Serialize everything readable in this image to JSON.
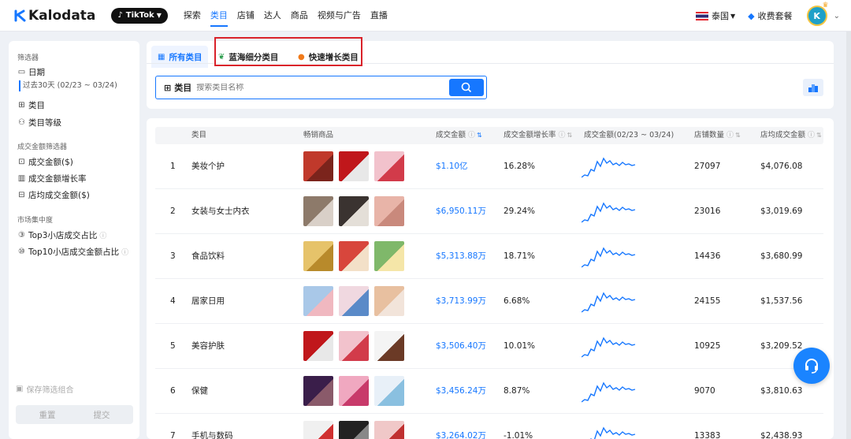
{
  "brand": {
    "name": "Kalodata",
    "platform": "TikTok"
  },
  "nav": [
    "探索",
    "类目",
    "店铺",
    "达人",
    "商品",
    "视频与广告",
    "直播"
  ],
  "nav_active": 1,
  "header": {
    "region": "泰国",
    "plan": "收费套餐",
    "avatar_letter": "K"
  },
  "sidebar": {
    "filters_title": "筛选器",
    "date_label": "日期",
    "date_range": "过去30天 (02/23 ~ 03/24)",
    "category_label": "类目",
    "category_level_label": "类目等级",
    "sales_filter_title": "成交金额筛选器",
    "sales_items": [
      "成交金额($)",
      "成交金额增长率",
      "店均成交金额($)"
    ],
    "market_title": "市场集中度",
    "market_items": [
      "Top3小店成交占比",
      "Top10小店成交金额占比"
    ],
    "save_combo": "保存筛选组合",
    "reset_label": "重置",
    "submit_label": "提交"
  },
  "tabs": [
    "所有类目",
    "蓝海细分类目",
    "快速增长类目"
  ],
  "search": {
    "category_label": "类目",
    "placeholder": "搜索类目名称"
  },
  "table": {
    "headers": [
      "类目",
      "畅销商品",
      "成交金额",
      "成交金额增长率",
      "成交金额(02/23 ~ 03/24)",
      "店铺数量",
      "店均成交金额"
    ],
    "rows": [
      {
        "rank": "1",
        "category": "美妆个护",
        "sales": "$1.10亿",
        "growth": "16.28%",
        "shops": "27097",
        "avg": "$4,076.08"
      },
      {
        "rank": "2",
        "category": "女装与女士内衣",
        "sales": "$6,950.11万",
        "growth": "29.24%",
        "shops": "23016",
        "avg": "$3,019.69"
      },
      {
        "rank": "3",
        "category": "食品饮料",
        "sales": "$5,313.88万",
        "growth": "18.71%",
        "shops": "14436",
        "avg": "$3,680.99"
      },
      {
        "rank": "4",
        "category": "居家日用",
        "sales": "$3,713.99万",
        "growth": "6.68%",
        "shops": "24155",
        "avg": "$1,537.56"
      },
      {
        "rank": "5",
        "category": "美容护肤",
        "sales": "$3,506.40万",
        "growth": "10.01%",
        "shops": "10925",
        "avg": "$3,209.52"
      },
      {
        "rank": "6",
        "category": "保健",
        "sales": "$3,456.24万",
        "growth": "8.87%",
        "shops": "9070",
        "avg": "$3,810.63"
      },
      {
        "rank": "7",
        "category": "手机与数码",
        "sales": "$3,264.02万",
        "growth": "-1.01%",
        "shops": "13383",
        "avg": "$2,438.93"
      }
    ]
  },
  "colors": {
    "accent": "#1677ff",
    "highlight_box": "#d9222a"
  }
}
